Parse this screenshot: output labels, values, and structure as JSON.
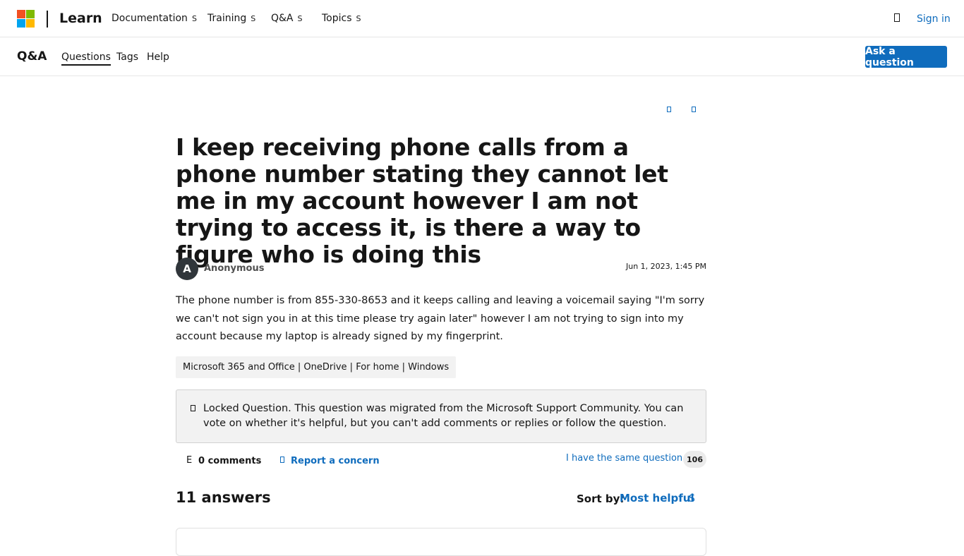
{
  "header": {
    "brand": "Learn",
    "nav": [
      {
        "label": "Documentation",
        "chevron": "S"
      },
      {
        "label": "Training",
        "chevron": "S"
      },
      {
        "label": "Q&A",
        "chevron": "S"
      },
      {
        "label": "Topics",
        "chevron": "S"
      }
    ],
    "signin_label": "Sign in",
    "icons": {
      "logo": "microsoft-logo",
      "profile": "profile-icon"
    },
    "logo_colors": [
      "#f25022",
      "#7fba00",
      "#00a4ef",
      "#ffb900"
    ]
  },
  "subheader": {
    "title": "Q&A",
    "nav": [
      "Questions",
      "Tags",
      "Help"
    ],
    "active_nav": "Questions",
    "ask_label": "Ask a question"
  },
  "question": {
    "title": "I keep receiving phone calls from a phone number stating they cannot let me in my account however I am not trying to access it, is there a way to figure who is doing this",
    "author": "Anonymous",
    "avatar_initial": "A",
    "date": "Jun 1, 2023, 1:45 PM",
    "body": "The phone number is from 855-330-8653 and it keeps calling and leaving a voicemail saying \"I'm sorry we can't not sign you in at this time please try again later\" however I am not trying to sign into my account because my laptop is already signed by my fingerprint.",
    "tags": "Microsoft 365 and Office | OneDrive | For home | Windows",
    "locked_notice": "Locked Question. This question was migrated from the Microsoft Support Community. You can vote on whether it's helpful, but you can't add comments or replies or follow the question.",
    "comments_icon_glyph": "E",
    "comments_label": "0 comments",
    "report_label": "Report a concern",
    "same_question_label": "I have the same question",
    "same_question_count": "106"
  },
  "answers": {
    "heading": "11 answers",
    "sort_label": "Sort by:",
    "sort_value": "Most helpful",
    "sort_chevron": "S"
  },
  "colors": {
    "accent": "#0f6cbd",
    "text": "#161616",
    "avatar": "#30363b"
  }
}
